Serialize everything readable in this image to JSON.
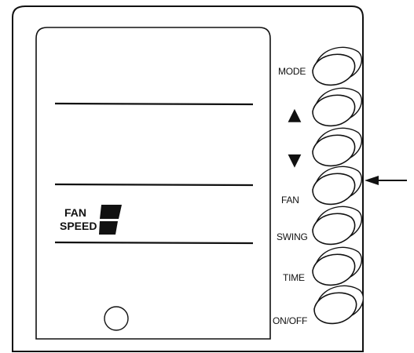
{
  "display": {
    "fan_label": "FAN",
    "speed_label": "SPEED"
  },
  "buttons": {
    "mode": "MODE",
    "up": "▲",
    "down": "▼",
    "fan": "FAN",
    "swing": "SWING",
    "time": "TIME",
    "on_off": "ON/OFF"
  },
  "fan_speed_level": "high",
  "highlighted_button": "fan",
  "colors": {
    "stroke": "#111111",
    "background": "#ffffff"
  }
}
